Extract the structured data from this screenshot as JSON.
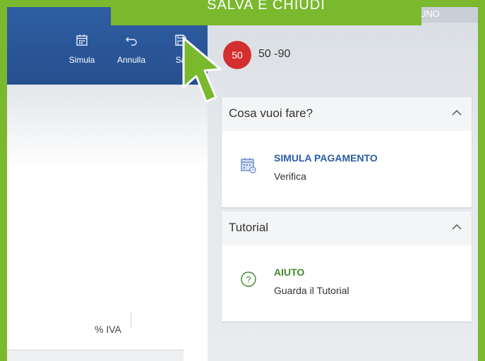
{
  "banner": {
    "text": "SALVA E CHIUDI",
    "color": "#7ab82e"
  },
  "toolbar": {
    "buttons": [
      {
        "label": "Simula",
        "icon": "calendar-icon"
      },
      {
        "label": "Annulla",
        "icon": "undo-icon"
      },
      {
        "label": "Sa",
        "icon": "save-icon"
      }
    ]
  },
  "top_right_text": "UNO",
  "customer": {
    "badge": "50",
    "name": "50 -90",
    "badge_color": "#d32f2f"
  },
  "sections": [
    {
      "title": "Cosa vuoi fare?",
      "item": {
        "title": "SIMULA PAGAMENTO",
        "subtitle": "Verifica",
        "icon": "calendar-icon",
        "color": "#2b5ca8"
      }
    },
    {
      "title": "Tutorial",
      "item": {
        "title": "AIUTO",
        "subtitle": "Guarda il Tutorial",
        "icon": "help-icon",
        "color": "#3f8a2c"
      }
    }
  ],
  "table": {
    "column_header": "% IVA"
  }
}
